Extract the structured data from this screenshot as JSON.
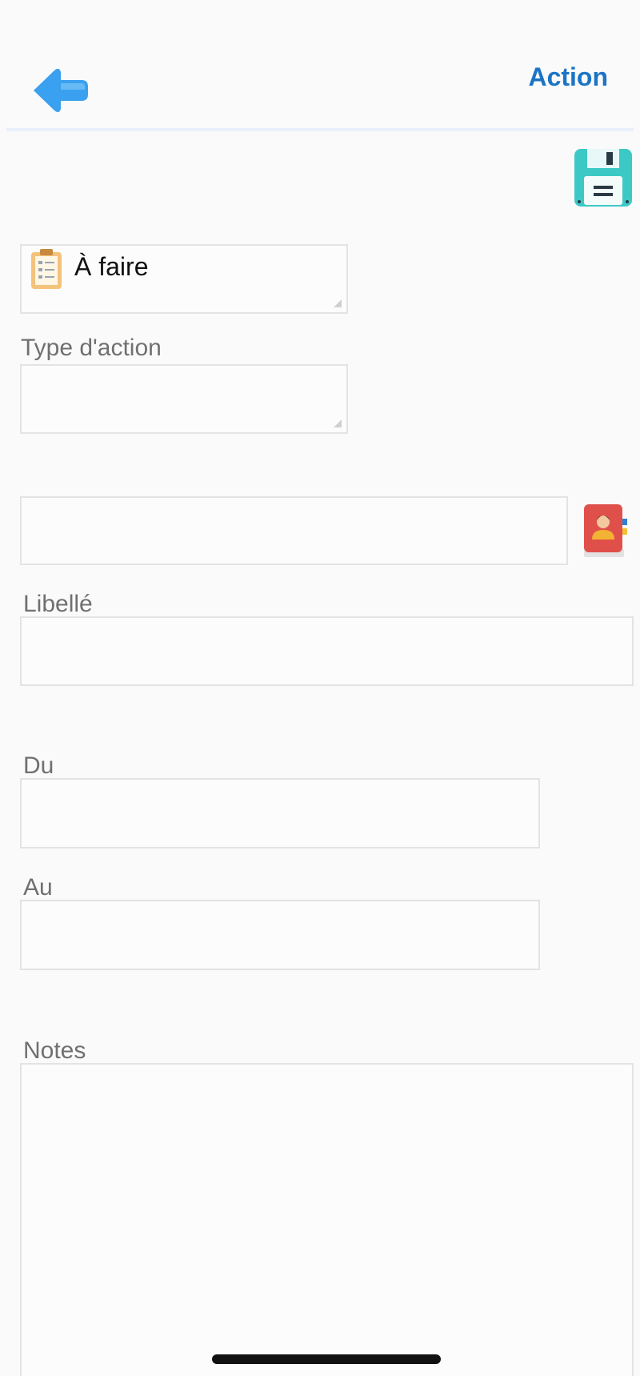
{
  "header": {
    "title": "Action",
    "back_icon": "arrow-left-icon"
  },
  "toolbar": {
    "save_icon": "floppy-disk-icon"
  },
  "status": {
    "value": "À faire",
    "icon": "clipboard-icon"
  },
  "form": {
    "type_label": "Type d'action",
    "type_value": "",
    "contact_value": "",
    "contact_icon": "address-book-icon",
    "libelle_label": "Libellé",
    "libelle_value": "",
    "du_label": "Du",
    "du_value": "",
    "au_label": "Au",
    "au_value": "",
    "notes_label": "Notes",
    "notes_value": ""
  },
  "colors": {
    "accent": "#1b74c5",
    "back_arrow": "#3aa0f0",
    "save_icon": "#3cc9c6",
    "contact_book": "#e0504a"
  }
}
